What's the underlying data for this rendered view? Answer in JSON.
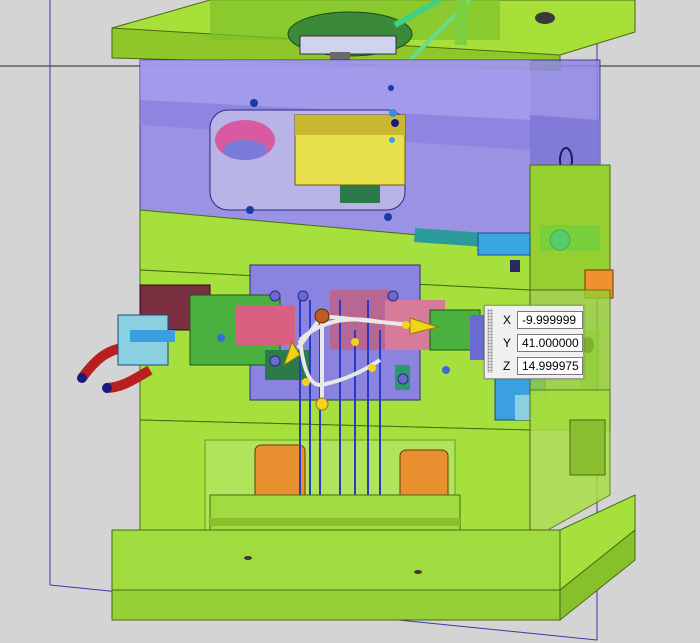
{
  "coord_input": {
    "x_label": "X",
    "y_label": "Y",
    "z_label": "Z",
    "x_value": "-9.999999",
    "y_value": "41.000000",
    "z_value": "14.999975"
  },
  "colors": {
    "background": "#d4d4d4",
    "plate_green": "#a6e03c",
    "plate_blue": "#8f86e8",
    "axis_arrow": "#f2d21a",
    "handle": "#c05a20"
  },
  "icons": [
    "move-triad-icon",
    "panel-grip-icon"
  ]
}
